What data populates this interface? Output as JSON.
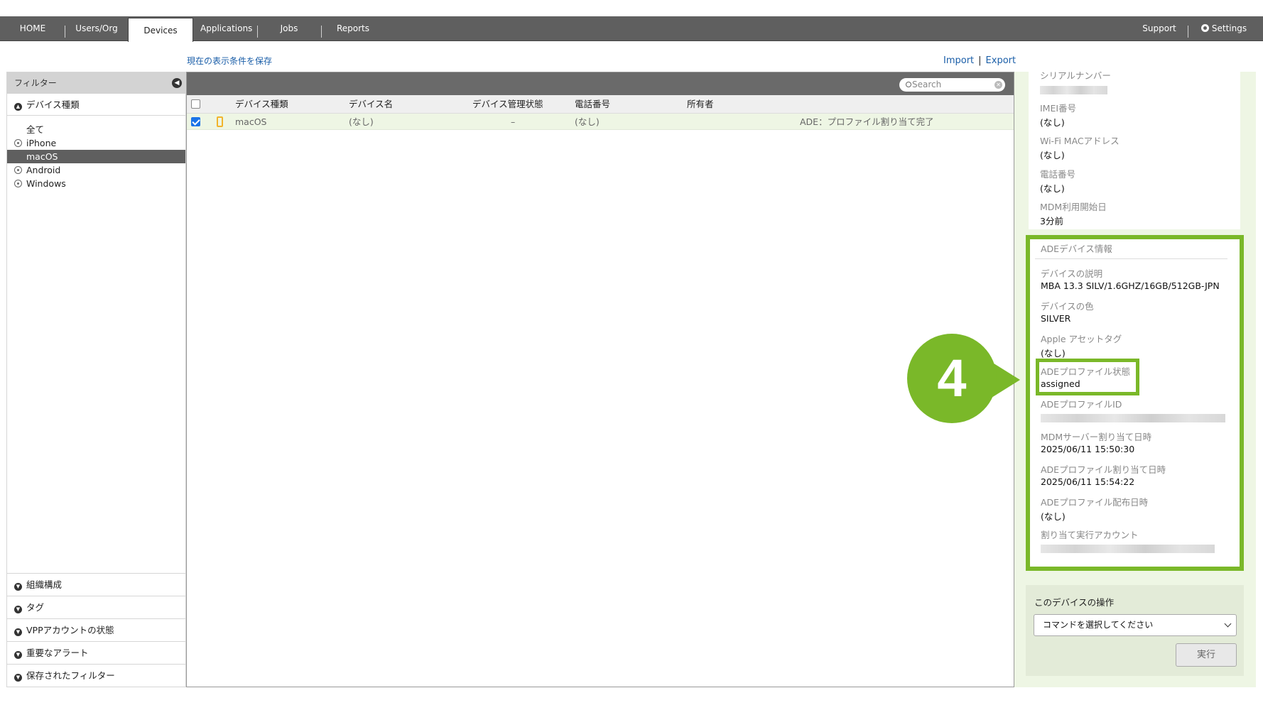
{
  "nav": {
    "home": "HOME",
    "users": "Users/Org",
    "devices": "Devices",
    "applications": "Applications",
    "jobs": "Jobs",
    "reports": "Reports",
    "support": "Support",
    "settings": "Settings"
  },
  "toolbar": {
    "save_view": "現在の表示条件を保存",
    "import": "Import",
    "separator": "|",
    "export": "Export"
  },
  "sidebar": {
    "header": "フィルター",
    "device_type_section": "デバイス種類",
    "items": [
      {
        "label": "全て"
      },
      {
        "label": "iPhone"
      },
      {
        "label": "macOS"
      },
      {
        "label": "Android"
      },
      {
        "label": "Windows"
      }
    ],
    "bottom_sections": [
      {
        "label": "組織構成"
      },
      {
        "label": "タグ"
      },
      {
        "label": "VPPアカウントの状態"
      },
      {
        "label": "重要なアラート"
      },
      {
        "label": "保存されたフィルター"
      }
    ]
  },
  "table": {
    "search_placeholder": "Search",
    "columns": [
      "デバイス種類",
      "デバイス名",
      "デバイス管理状態",
      "電話番号",
      "所有者"
    ],
    "rows": [
      {
        "checked": true,
        "device_type": "macOS",
        "device_name": "(なし)",
        "mgmt_state": "–",
        "phone": "(なし)",
        "owner": "",
        "status": "ADE：プロファイル割り当て完了"
      }
    ]
  },
  "details": {
    "serial_label": "シリアルナンバー",
    "imei_label": "IMEI番号",
    "imei_value": "(なし)",
    "wifi_label": "Wi-Fi MACアドレス",
    "wifi_value": "(なし)",
    "phone_label": "電話番号",
    "phone_value": "(なし)",
    "mdm_start_label": "MDM利用開始日",
    "mdm_start_value": "3分前"
  },
  "ade": {
    "title": "ADEデバイス情報",
    "desc_label": "デバイスの説明",
    "desc_value": "MBA 13.3 SILV/1.6GHZ/16GB/512GB-JPN",
    "color_label": "デバイスの色",
    "color_value": "SILVER",
    "asset_label": "Apple アセットタグ",
    "asset_value": "(なし)",
    "profile_state_label": "ADEプロファイル状態",
    "profile_state_value": "assigned",
    "profile_id_label": "ADEプロファイルID",
    "mdm_assign_label": "MDMサーバー割り当て日時",
    "mdm_assign_value": "2025/06/11 15:50:30",
    "profile_assign_label": "ADEプロファイル割り当て日時",
    "profile_assign_value": "2025/06/11 15:54:22",
    "profile_push_label": "ADEプロファイル配布日時",
    "profile_push_value": "(なし)",
    "account_label": "割り当て実行アカウント"
  },
  "callout": {
    "number": "4"
  },
  "operations": {
    "title": "このデバイスの操作",
    "select_value": "コマンドを選択してください",
    "run_button": "実行"
  },
  "colors": {
    "accent_green": "#7ab829",
    "nav_bg": "#5f5f5f",
    "link_blue": "#1a5ea8"
  }
}
